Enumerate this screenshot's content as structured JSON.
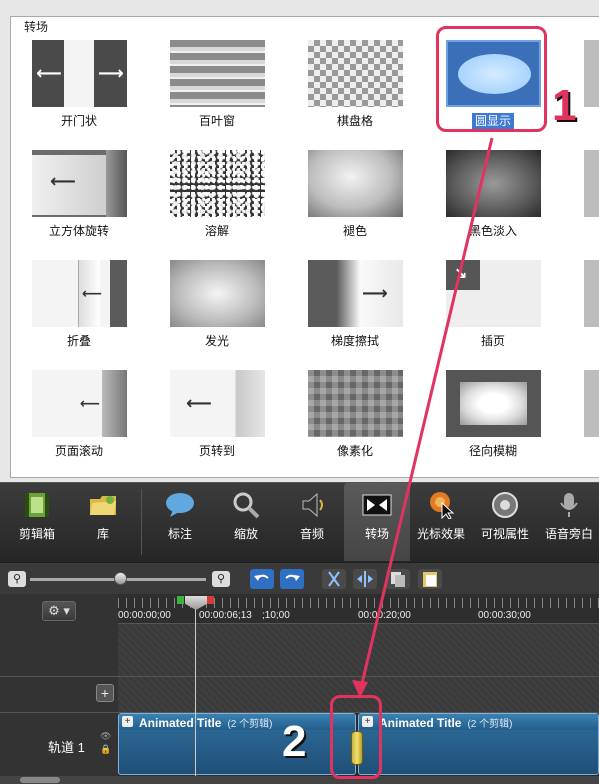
{
  "gallery": {
    "group_title": "转场",
    "tiles": [
      {
        "label": "开门状",
        "selected": false
      },
      {
        "label": "百叶窗",
        "selected": false
      },
      {
        "label": "棋盘格",
        "selected": false
      },
      {
        "label": "圆显示",
        "selected": true
      },
      {
        "label": "立方体旋转",
        "selected": false
      },
      {
        "label": "溶解",
        "selected": false
      },
      {
        "label": "褪色",
        "selected": false
      },
      {
        "label": "黑色淡入",
        "selected": false
      },
      {
        "label": "折叠",
        "selected": false
      },
      {
        "label": "发光",
        "selected": false
      },
      {
        "label": "梯度擦拭",
        "selected": false
      },
      {
        "label": "插页",
        "selected": false
      },
      {
        "label": "页面滚动",
        "selected": false
      },
      {
        "label": "页转到",
        "selected": false
      },
      {
        "label": "像素化",
        "selected": false
      },
      {
        "label": "径向模糊",
        "selected": false
      }
    ]
  },
  "annotations": {
    "step1": "1",
    "step2": "2"
  },
  "tabs": [
    {
      "label": "剪辑箱",
      "icon": "film-strip-icon",
      "active": false
    },
    {
      "label": "库",
      "icon": "folder-icon",
      "active": false
    },
    {
      "label": "标注",
      "icon": "speech-bubble-icon",
      "active": false
    },
    {
      "label": "缩放",
      "icon": "magnifier-icon",
      "active": false
    },
    {
      "label": "音频",
      "icon": "speaker-icon",
      "active": false
    },
    {
      "label": "转场",
      "icon": "transition-icon",
      "active": true
    },
    {
      "label": "光标效果",
      "icon": "cursor-effect-icon",
      "active": false
    },
    {
      "label": "可视属性",
      "icon": "visual-properties-icon",
      "active": false
    },
    {
      "label": "语音旁白",
      "icon": "microphone-icon",
      "active": false
    }
  ],
  "timeline": {
    "timecodes": [
      "00:00:00;00",
      "00:00:06;13",
      ";10;00",
      "00:00:20;00",
      "00:00:30;00"
    ],
    "track_label": "轨道 1",
    "clips": [
      {
        "title": "Animated Title",
        "count": "(2 个剪辑)"
      },
      {
        "title": "Animated Title",
        "count": "(2 个剪辑)"
      }
    ]
  },
  "colors": {
    "annotation": "#e2335f",
    "selection": "#3d7ad3"
  }
}
